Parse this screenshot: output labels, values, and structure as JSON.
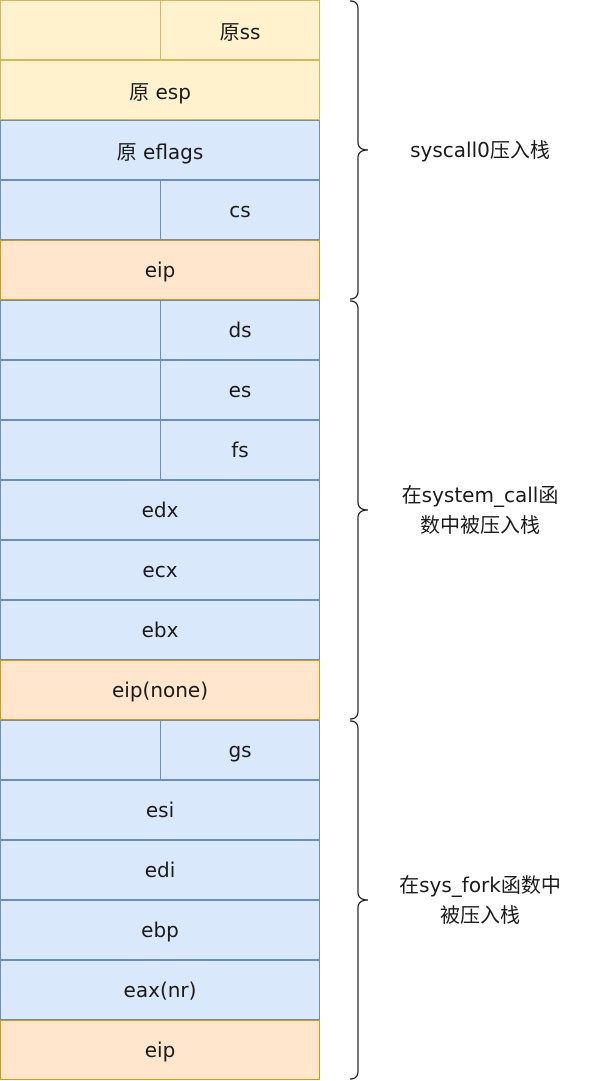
{
  "rows": [
    {
      "label": "原ss",
      "split": true,
      "color": "yellow"
    },
    {
      "label": "原 esp",
      "split": false,
      "color": "yellow"
    },
    {
      "label": "原 eflags",
      "split": false,
      "color": "blue"
    },
    {
      "label": "cs",
      "split": true,
      "color": "blue"
    },
    {
      "label": "eip",
      "split": false,
      "color": "orange"
    },
    {
      "label": "ds",
      "split": true,
      "color": "blue"
    },
    {
      "label": "es",
      "split": true,
      "color": "blue"
    },
    {
      "label": "fs",
      "split": true,
      "color": "blue"
    },
    {
      "label": "edx",
      "split": false,
      "color": "blue"
    },
    {
      "label": "ecx",
      "split": false,
      "color": "blue"
    },
    {
      "label": "ebx",
      "split": false,
      "color": "blue"
    },
    {
      "label": "eip(none)",
      "split": false,
      "color": "orange"
    },
    {
      "label": "gs",
      "split": true,
      "color": "blue"
    },
    {
      "label": "esi",
      "split": false,
      "color": "blue"
    },
    {
      "label": "edi",
      "split": false,
      "color": "blue"
    },
    {
      "label": "ebp",
      "split": false,
      "color": "blue"
    },
    {
      "label": "eax(nr)",
      "split": false,
      "color": "blue"
    },
    {
      "label": "eip",
      "split": false,
      "color": "orange"
    }
  ],
  "groups": [
    {
      "lines": [
        "syscall0压入栈"
      ],
      "first_row": 0,
      "last_row": 4
    },
    {
      "lines": [
        "在system_call函",
        "数中被压入栈"
      ],
      "first_row": 5,
      "last_row": 11
    },
    {
      "lines": [
        "在sys_fork函数中",
        "被压入栈"
      ],
      "first_row": 12,
      "last_row": 17
    }
  ],
  "colors": {
    "yellow": "#fff2cc",
    "blue": "#dae8fc",
    "orange": "#ffe6cc",
    "brace": "#1a1a1a"
  }
}
